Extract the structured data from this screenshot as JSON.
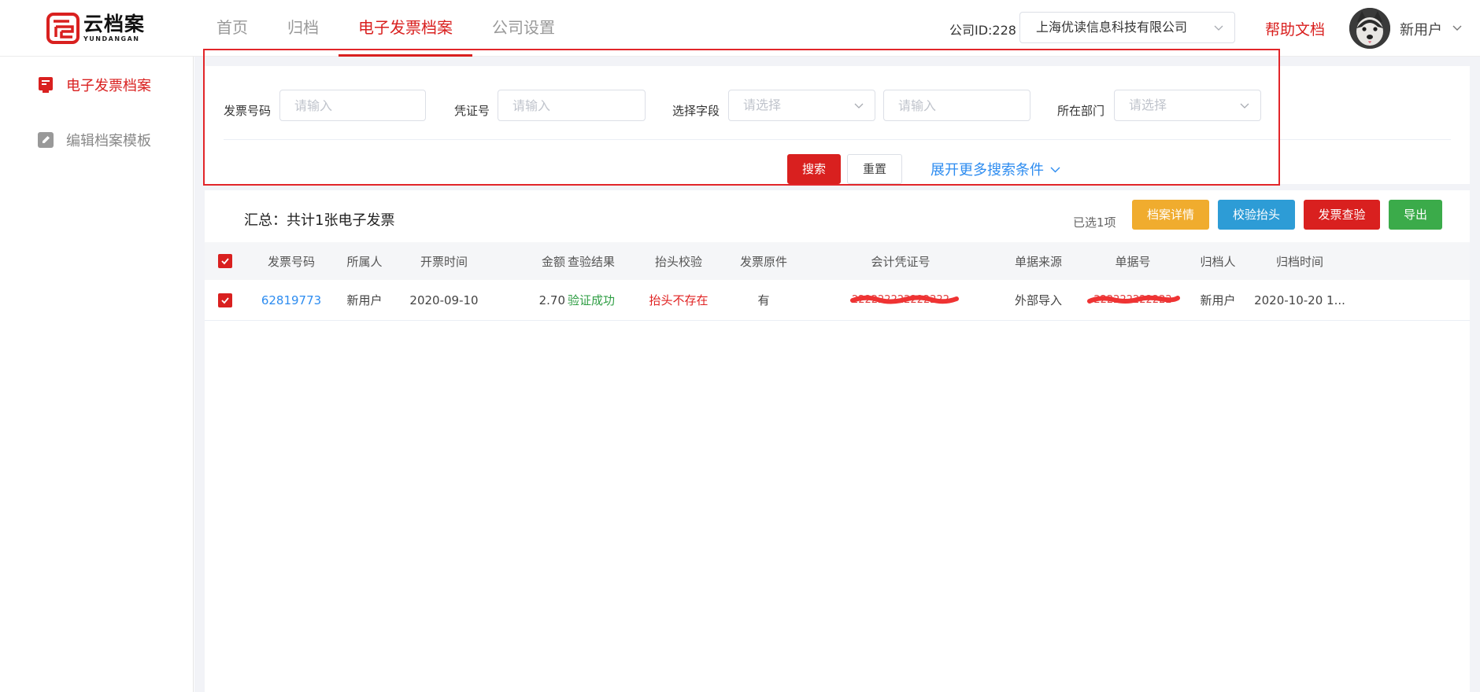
{
  "logo": {
    "cn": "云档案",
    "en": "YUNDANGAN"
  },
  "nav": {
    "items": [
      {
        "label": "首页"
      },
      {
        "label": "归档"
      },
      {
        "label": "电子发票档案",
        "active": true
      },
      {
        "label": "公司设置"
      }
    ]
  },
  "header": {
    "company_id": "公司ID:228",
    "company_name": "上海优读信息科技有限公司",
    "help": "帮助文档",
    "username": "新用户"
  },
  "sidebar": {
    "items": [
      {
        "label": "电子发票档案",
        "icon": "invoice-icon",
        "active": true
      },
      {
        "label": "编辑档案模板",
        "icon": "edit-icon",
        "active": false
      }
    ]
  },
  "search": {
    "invoice_no_label": "发票号码",
    "invoice_no_placeholder": "请输入",
    "voucher_label": "凭证号",
    "voucher_placeholder": "请输入",
    "field_label": "选择字段",
    "field_select_placeholder": "请选择",
    "field_value_placeholder": "请输入",
    "dept_label": "所在部门",
    "dept_placeholder": "请选择",
    "search_btn": "搜索",
    "reset_btn": "重置",
    "expand_link": "展开更多搜索条件"
  },
  "table": {
    "summary": "汇总：共计1张电子发票",
    "selected": "已选1项",
    "actions": {
      "detail": "档案详情",
      "verify_head": "校验抬头",
      "check": "发票查验",
      "export": "导出"
    },
    "columns": [
      "发票号码",
      "所属人",
      "开票时间",
      "金额",
      "查验结果",
      "抬头校验",
      "发票原件",
      "会计凭证号",
      "单据来源",
      "单据号",
      "归档人",
      "归档时间"
    ],
    "rows": [
      {
        "checked": true,
        "invoice_no": "62819773",
        "owner": "新用户",
        "issue_date": "2020-09-10",
        "amount": "2.70",
        "check_result": "验证成功",
        "head_check": "抬头不存在",
        "original": "有",
        "voucher_no": "222222222222222",
        "source": "外部导入",
        "doc_no": "222222222222",
        "archiver": "新用户",
        "archive_time": "2020-10-20 1..."
      }
    ]
  },
  "colors": {
    "brand_red": "#d9201f",
    "warning": "#f0ac2e",
    "info": "#2d9cd6",
    "success": "#3bab4a",
    "link": "#2d8cf0"
  }
}
